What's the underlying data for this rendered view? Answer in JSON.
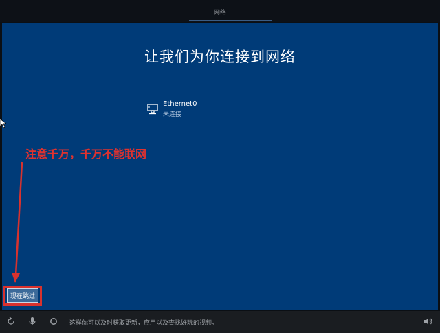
{
  "top_bar": {
    "title": "网络"
  },
  "main": {
    "title": "让我们为你连接到网络",
    "network": {
      "name": "Ethernet0",
      "status": "未连接",
      "icon": "ethernet-icon"
    },
    "annotation": {
      "text": "注意千万，千万不能联网",
      "color": "#e0322f"
    },
    "skip_button_label": "现在跳过"
  },
  "bottom_bar": {
    "hint": "这样你可以及时获取更新，应用以及查找好玩的视频。",
    "icons": [
      "accessibility-icon",
      "microphone-icon",
      "cortana-icon",
      "volume-icon"
    ]
  },
  "colors": {
    "panel_bg": "#003b78",
    "accent_red": "#d8322e"
  }
}
